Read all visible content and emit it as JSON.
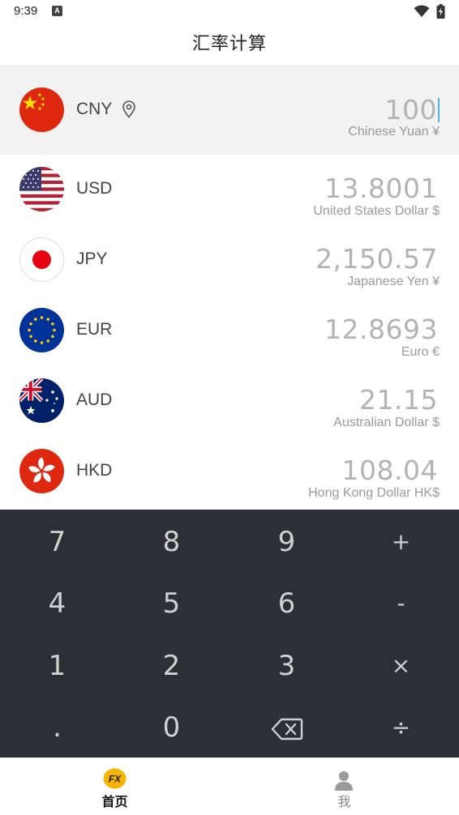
{
  "status_bar": {
    "time": "9:39",
    "notification": "A"
  },
  "header": {
    "title": "汇率计算"
  },
  "base": {
    "code": "CNY",
    "amount": "100",
    "name": "Chinese Yuan ¥"
  },
  "currencies": [
    {
      "code": "USD",
      "amount": "13.8001",
      "name": "United States Dollar $"
    },
    {
      "code": "JPY",
      "amount": "2,150.57",
      "name": "Japanese Yen ¥"
    },
    {
      "code": "EUR",
      "amount": "12.8693",
      "name": "Euro €"
    },
    {
      "code": "AUD",
      "amount": "21.15",
      "name": "Australian Dollar $"
    },
    {
      "code": "HKD",
      "amount": "108.04",
      "name": "Hong Kong Dollar HK$"
    }
  ],
  "keypad": {
    "k7": "7",
    "k8": "8",
    "k9": "9",
    "plus": "+",
    "k4": "4",
    "k5": "5",
    "k6": "6",
    "minus": "-",
    "k1": "1",
    "k2": "2",
    "k3": "3",
    "times": "×",
    "dot": ".",
    "k0": "0",
    "divide": "÷",
    "backspace_icon": "backspace-icon"
  },
  "tabs": [
    {
      "label": "首页",
      "icon": "fx-icon",
      "active": true
    },
    {
      "label": "我",
      "icon": "person-icon",
      "active": false
    }
  ],
  "colors": {
    "keypad_bg": "#2c2f36",
    "cursor": "#4fb3e8",
    "fx_badge": "#f5b400"
  }
}
